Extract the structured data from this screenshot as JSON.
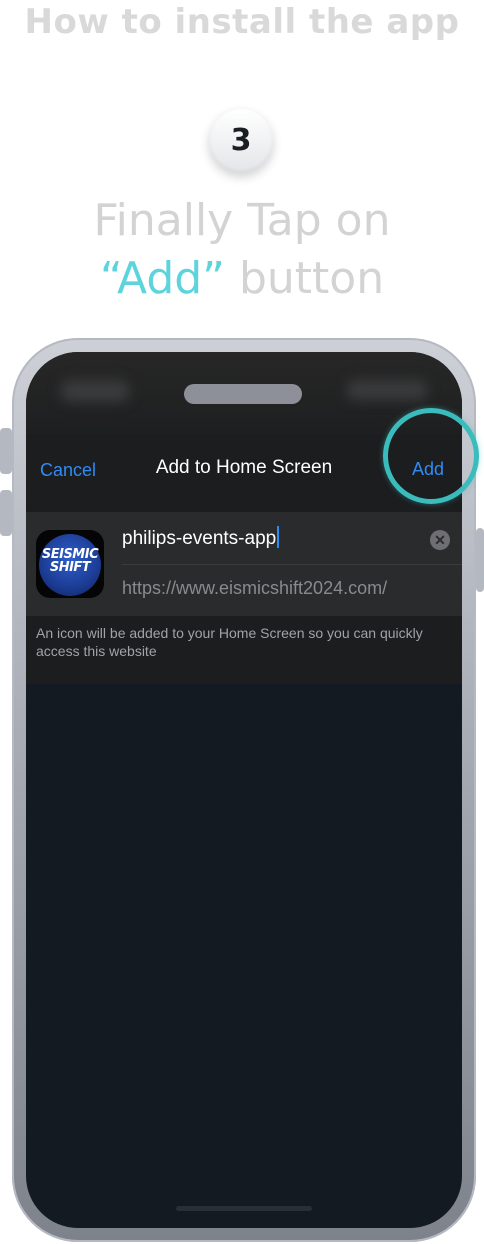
{
  "header": {
    "title": "How to install the app"
  },
  "step": {
    "number": "3"
  },
  "instruction": {
    "line1": "Finally Tap on",
    "accent": "“Add”",
    "line2_rest": " button"
  },
  "colors": {
    "accent_teal": "#5dd4dc",
    "ios_blue": "#2f8cf5",
    "highlight_ring": "#3bbcbc"
  },
  "dialog": {
    "cancel_label": "Cancel",
    "title": "Add to Home Screen",
    "add_label": "Add",
    "app_name_value": "philips-events-app",
    "url": "https://www.eismicshift2024.com/",
    "footnote": "An icon will be added to your Home Screen so you can quickly access this website",
    "app_icon": {
      "logo_line1": "SEISMIC",
      "logo_line2": "SHIFT"
    },
    "clear_icon": "clear-circle-icon"
  }
}
